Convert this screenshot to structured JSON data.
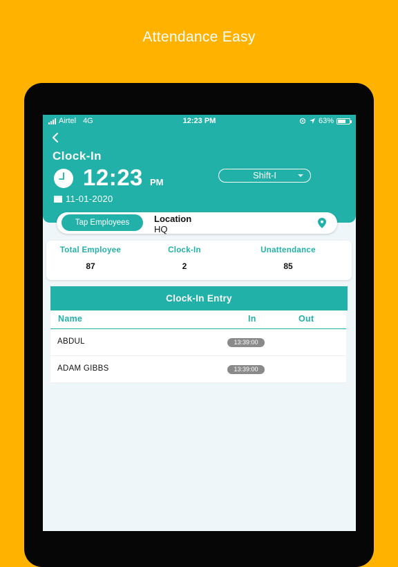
{
  "banner": {
    "title": "Attendance Easy"
  },
  "status_bar": {
    "carrier": "Airtel",
    "network": "4G",
    "time": "12:23 PM",
    "battery": "63%"
  },
  "header": {
    "title": "Clock-In",
    "time": "12:23",
    "ampm": "PM",
    "shift": "Shift-I",
    "date": "11-01-2020"
  },
  "location_bar": {
    "tap_button": "Tap Employees",
    "label": "Location",
    "value": "HQ"
  },
  "stats": [
    {
      "label": "Total Employee",
      "value": "87"
    },
    {
      "label": "Clock-In",
      "value": "2"
    },
    {
      "label": "Unattendance",
      "value": "85"
    }
  ],
  "entry": {
    "title": "Clock-In Entry",
    "columns": {
      "name": "Name",
      "in": "In",
      "out": "Out"
    },
    "rows": [
      {
        "name": "ABDUL",
        "in": "13:39:00",
        "out": ""
      },
      {
        "name": "ADAM GIBBS",
        "in": "13:39:00",
        "out": ""
      }
    ]
  },
  "colors": {
    "accent": "#22B1A8",
    "background": "#FFB300",
    "badge": "#8A8A8A"
  },
  "icons": [
    "back-arrow-icon",
    "clock-icon",
    "calendar-icon",
    "location-pin-icon",
    "chevron-down-icon",
    "battery-icon",
    "signal-icon"
  ]
}
